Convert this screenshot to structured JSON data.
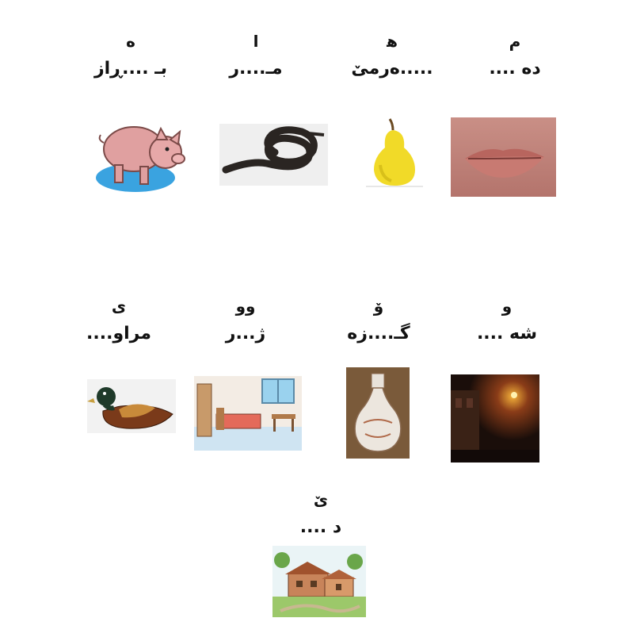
{
  "items": [
    {
      "letter": "م",
      "word": "دە ....",
      "image_icon": "lips-icon"
    },
    {
      "letter": "ه‍",
      "word": ".....ەرمێ",
      "image_icon": "pear-icon"
    },
    {
      "letter": "ا",
      "word": "مـ....ر",
      "image_icon": "snake-icon"
    },
    {
      "letter": "ە",
      "word": "بـ ....ڕاز",
      "image_icon": "pig-icon"
    },
    {
      "letter": "و",
      "word": "شە ....",
      "image_icon": "night-street-icon"
    },
    {
      "letter": "ۆ",
      "word": "گـ....زە",
      "image_icon": "jug-icon"
    },
    {
      "letter": "وو",
      "word": "ژ...ر",
      "image_icon": "bedroom-icon"
    },
    {
      "letter": "ی",
      "word": "مراو....",
      "image_icon": "duck-icon"
    },
    {
      "letter": "ێ",
      "word": "د ....",
      "image_icon": "village-icon"
    }
  ]
}
